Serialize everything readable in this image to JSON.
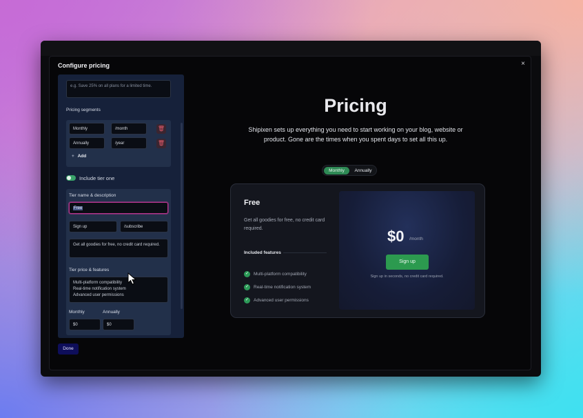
{
  "modal": {
    "title": "Configure pricing",
    "close": "×",
    "done_label": "Done"
  },
  "form": {
    "banner_placeholder": "e.g. Save 25% on all plans for a limited time.",
    "segments_label": "Pricing segments",
    "segments": [
      {
        "name": "Monthly",
        "suffix": "/month"
      },
      {
        "name": "Annually",
        "suffix": "/year"
      }
    ],
    "add_label": "Add",
    "include_tier_label": "Include tier one",
    "tier_name_label": "Tier name & description",
    "tier_name_value": "Free",
    "cta_label_value": "Sign up",
    "cta_link_value": "/subscribe",
    "description_value": "Get all goodies for free, no credit card required.",
    "price_features_label": "Tier price & features",
    "features_lines": [
      "Multi-platform compatibility",
      "Real-time notification system",
      "Advanced user permissions"
    ],
    "monthly_label": "Monthly",
    "annually_label": "Annually",
    "monthly_price": "$0",
    "annually_price": "$0"
  },
  "preview": {
    "title": "Pricing",
    "description": "Shipixen sets up everything you need to start working on your blog, website or product. Gone are the times when you spent days to set all this up.",
    "period_options": [
      "Monthly",
      "Annually"
    ],
    "selected_period": "Monthly",
    "card": {
      "tier_name": "Free",
      "description": "Get all goodies for free, no credit card required.",
      "included_label": "Included features",
      "features": [
        "Multi-platform compatibility",
        "Real-time notification system",
        "Advanced user permissions"
      ],
      "price": "$0",
      "price_period": "/month",
      "cta": "Sign up",
      "cta_note": "Sign up in seconds, no credit card required."
    }
  },
  "colors": {
    "accent_green": "#2c9a4f",
    "selection_border": "#b8358f",
    "done_button": "#0e0e5a"
  }
}
